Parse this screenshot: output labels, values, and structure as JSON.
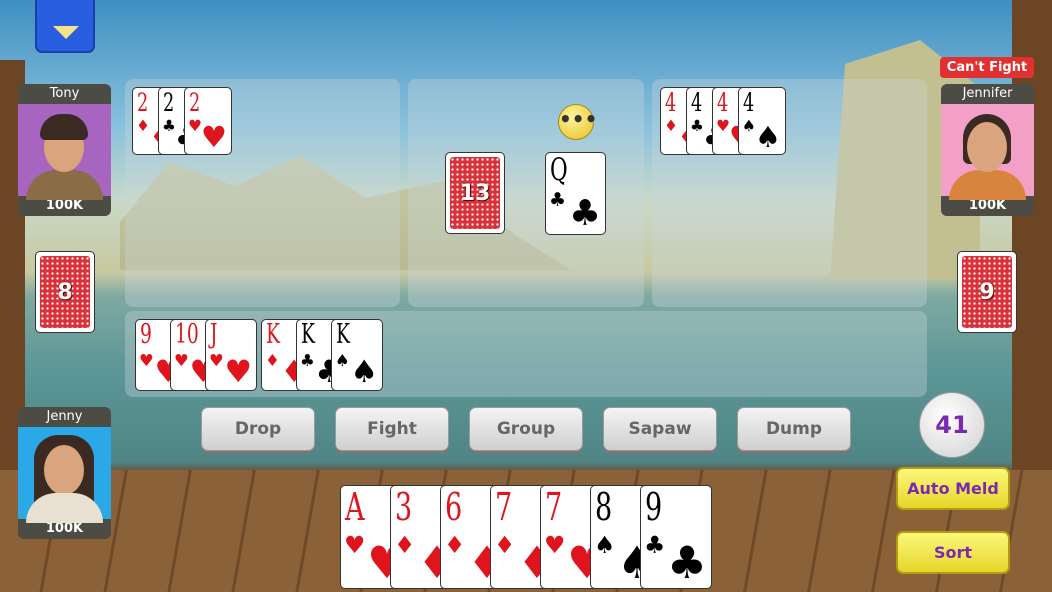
{
  "menu_button": {
    "icon": "triangle-down-icon",
    "color": "#2a5ee0"
  },
  "status_badge": "Can't Fight",
  "players": {
    "tony": {
      "name": "Tony",
      "chips": "100K",
      "bg": "#a865c0",
      "pile_count": "8"
    },
    "jennifer": {
      "name": "Jennifer",
      "chips": "100K",
      "bg": "#f2a0c8",
      "pile_count": "9"
    },
    "jenny": {
      "name": "Jenny",
      "chips": "100K",
      "bg": "#2aa8e8"
    }
  },
  "melds": {
    "tony": [
      {
        "rank": "2",
        "suit": "♦"
      },
      {
        "rank": "2",
        "suit": "♣"
      },
      {
        "rank": "2",
        "suit": "♥"
      }
    ],
    "jennifer": [
      {
        "rank": "4",
        "suit": "♦"
      },
      {
        "rank": "4",
        "suit": "♣"
      },
      {
        "rank": "4",
        "suit": "♥"
      },
      {
        "rank": "4",
        "suit": "♠"
      }
    ],
    "mine": [
      {
        "rank": "9",
        "suit": "♥"
      },
      {
        "rank": "10",
        "suit": "♥"
      },
      {
        "rank": "J",
        "suit": "♥"
      },
      {
        "rank": "K",
        "suit": "♦"
      },
      {
        "rank": "K",
        "suit": "♣"
      },
      {
        "rank": "K",
        "suit": "♠"
      }
    ]
  },
  "center": {
    "stock_count": "13",
    "discard": {
      "rank": "Q",
      "suit": "♣"
    },
    "thinking_icon": "ellipsis-icon"
  },
  "hand": [
    {
      "rank": "A",
      "suit": "♥"
    },
    {
      "rank": "3",
      "suit": "♦"
    },
    {
      "rank": "6",
      "suit": "♦"
    },
    {
      "rank": "7",
      "suit": "♦"
    },
    {
      "rank": "7",
      "suit": "♥"
    },
    {
      "rank": "8",
      "suit": "♠"
    },
    {
      "rank": "9",
      "suit": "♣"
    }
  ],
  "actions": [
    "Drop",
    "Fight",
    "Group",
    "Sapaw",
    "Dump"
  ],
  "timer": "41",
  "auto_meld_label": "Auto Meld",
  "sort_label": "Sort"
}
